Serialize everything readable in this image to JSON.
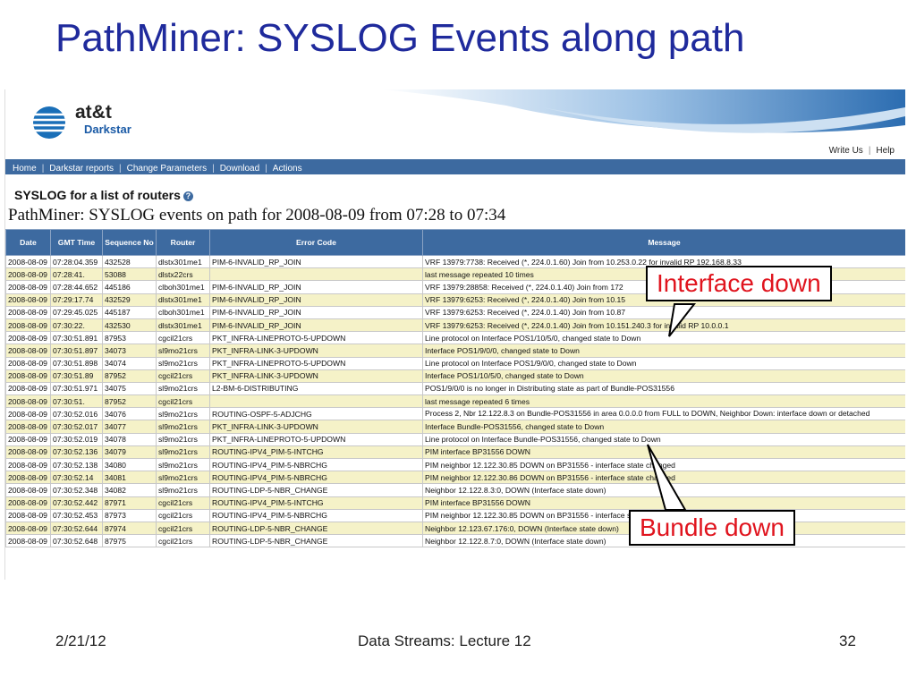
{
  "slide": {
    "title": "PathMiner: SYSLOG Events along path",
    "footer_date": "2/21/12",
    "footer_center": "Data Streams: Lecture 12",
    "footer_page": "32"
  },
  "app": {
    "brand": "at&t",
    "product": "Darkstar",
    "top_links": [
      "Write Us",
      "Help"
    ],
    "nav": [
      "Home",
      "Darkstar reports",
      "Change Parameters",
      "Download",
      "Actions"
    ],
    "section_title": "SYSLOG for a list of routers",
    "help_icon": "?",
    "report_title": "PathMiner: SYSLOG events on path for 2008-08-09 from 07:28 to 07:34"
  },
  "table": {
    "headers": [
      "Date",
      "GMT Time",
      "Sequence No",
      "Router",
      "Error Code",
      "Message"
    ],
    "rows": [
      [
        "2008-08-09",
        "07:28:04.359",
        "432528",
        "dlstx301me1",
        "PIM-6-INVALID_RP_JOIN",
        "VRF 13979:7738: Received (*, 224.0.1.60) Join from 10.253.0.22 for invalid RP 192.168.8.33"
      ],
      [
        "2008-08-09",
        "07:28:41.",
        "53088",
        "dlstx22crs",
        "",
        "last message repeated 10 times"
      ],
      [
        "2008-08-09",
        "07:28:44.652",
        "445186",
        "clboh301me1",
        "PIM-6-INVALID_RP_JOIN",
        "VRF 13979:28858: Received (*, 224.0.1.40) Join from 172"
      ],
      [
        "2008-08-09",
        "07:29:17.74",
        "432529",
        "dlstx301me1",
        "PIM-6-INVALID_RP_JOIN",
        "VRF 13979:6253: Received (*, 224.0.1.40) Join from 10.15"
      ],
      [
        "2008-08-09",
        "07:29:45.025",
        "445187",
        "clboh301me1",
        "PIM-6-INVALID_RP_JOIN",
        "VRF 13979:6253: Received (*, 224.0.1.40) Join from 10.87"
      ],
      [
        "2008-08-09",
        "07:30:22.",
        "432530",
        "dlstx301me1",
        "PIM-6-INVALID_RP_JOIN",
        "VRF 13979:6253: Received (*, 224.0.1.40) Join from 10.151.240.3 for invalid RP 10.0.0.1"
      ],
      [
        "2008-08-09",
        "07:30:51.891",
        "87953",
        "cgcil21crs",
        "PKT_INFRA-LINEPROTO-5-UPDOWN",
        "Line protocol on Interface POS1/10/5/0, changed state to Down"
      ],
      [
        "2008-08-09",
        "07:30:51.897",
        "34073",
        "sl9mo21crs",
        "PKT_INFRA-LINK-3-UPDOWN",
        "Interface POS1/9/0/0, changed state to Down"
      ],
      [
        "2008-08-09",
        "07:30:51.898",
        "34074",
        "sl9mo21crs",
        "PKT_INFRA-LINEPROTO-5-UPDOWN",
        "Line protocol on Interface POS1/9/0/0, changed state to Down"
      ],
      [
        "2008-08-09",
        "07:30:51.89",
        "87952",
        "cgcil21crs",
        "PKT_INFRA-LINK-3-UPDOWN",
        "Interface POS1/10/5/0, changed state to Down"
      ],
      [
        "2008-08-09",
        "07:30:51.971",
        "34075",
        "sl9mo21crs",
        "L2-BM-6-DISTRIBUTING",
        "POS1/9/0/0 is no longer in Distributing state as part of Bundle-POS31556"
      ],
      [
        "2008-08-09",
        "07:30:51.",
        "87952",
        "cgcil21crs",
        "",
        "last message repeated 6 times"
      ],
      [
        "2008-08-09",
        "07:30:52.016",
        "34076",
        "sl9mo21crs",
        "ROUTING-OSPF-5-ADJCHG",
        "Process 2, Nbr 12.122.8.3 on Bundle-POS31556 in area 0.0.0.0 from FULL to DOWN, Neighbor Down: interface down or detached"
      ],
      [
        "2008-08-09",
        "07:30:52.017",
        "34077",
        "sl9mo21crs",
        "PKT_INFRA-LINK-3-UPDOWN",
        "Interface Bundle-POS31556, changed state to Down"
      ],
      [
        "2008-08-09",
        "07:30:52.019",
        "34078",
        "sl9mo21crs",
        "PKT_INFRA-LINEPROTO-5-UPDOWN",
        "Line protocol on Interface Bundle-POS31556, changed state to Down"
      ],
      [
        "2008-08-09",
        "07:30:52.136",
        "34079",
        "sl9mo21crs",
        "ROUTING-IPV4_PIM-5-INTCHG",
        "PIM interface BP31556 DOWN"
      ],
      [
        "2008-08-09",
        "07:30:52.138",
        "34080",
        "sl9mo21crs",
        "ROUTING-IPV4_PIM-5-NBRCHG",
        "PIM neighbor 12.122.30.85 DOWN on BP31556 - interface state changed"
      ],
      [
        "2008-08-09",
        "07:30:52.14",
        "34081",
        "sl9mo21crs",
        "ROUTING-IPV4_PIM-5-NBRCHG",
        "PIM neighbor 12.122.30.86 DOWN on BP31556 - interface state changed"
      ],
      [
        "2008-08-09",
        "07:30:52.348",
        "34082",
        "sl9mo21crs",
        "ROUTING-LDP-5-NBR_CHANGE",
        "Neighbor 12.122.8.3:0, DOWN (Interface state down)"
      ],
      [
        "2008-08-09",
        "07:30:52.442",
        "87971",
        "cgcil21crs",
        "ROUTING-IPV4_PIM-5-INTCHG",
        "PIM interface BP31556 DOWN"
      ],
      [
        "2008-08-09",
        "07:30:52.453",
        "87973",
        "cgcil21crs",
        "ROUTING-IPV4_PIM-5-NBRCHG",
        "PIM neighbor 12.122.30.85 DOWN on BP31556 - interface state changed"
      ],
      [
        "2008-08-09",
        "07:30:52.644",
        "87974",
        "cgcil21crs",
        "ROUTING-LDP-5-NBR_CHANGE",
        "Neighbor 12.123.67.176:0, DOWN (Interface state down)"
      ],
      [
        "2008-08-09",
        "07:30:52.648",
        "87975",
        "cgcil21crs",
        "ROUTING-LDP-5-NBR_CHANGE",
        "Neighbor 12.122.8.7:0, DOWN (Interface state down)"
      ]
    ]
  },
  "callouts": {
    "interface_down": "Interface down",
    "bundle_down": "Bundle down"
  },
  "colors": {
    "title": "#1f2a9c",
    "nav_bar": "#3d6aa0",
    "row_alt": "#f5f2c8",
    "callout_text": "#e0141e"
  }
}
